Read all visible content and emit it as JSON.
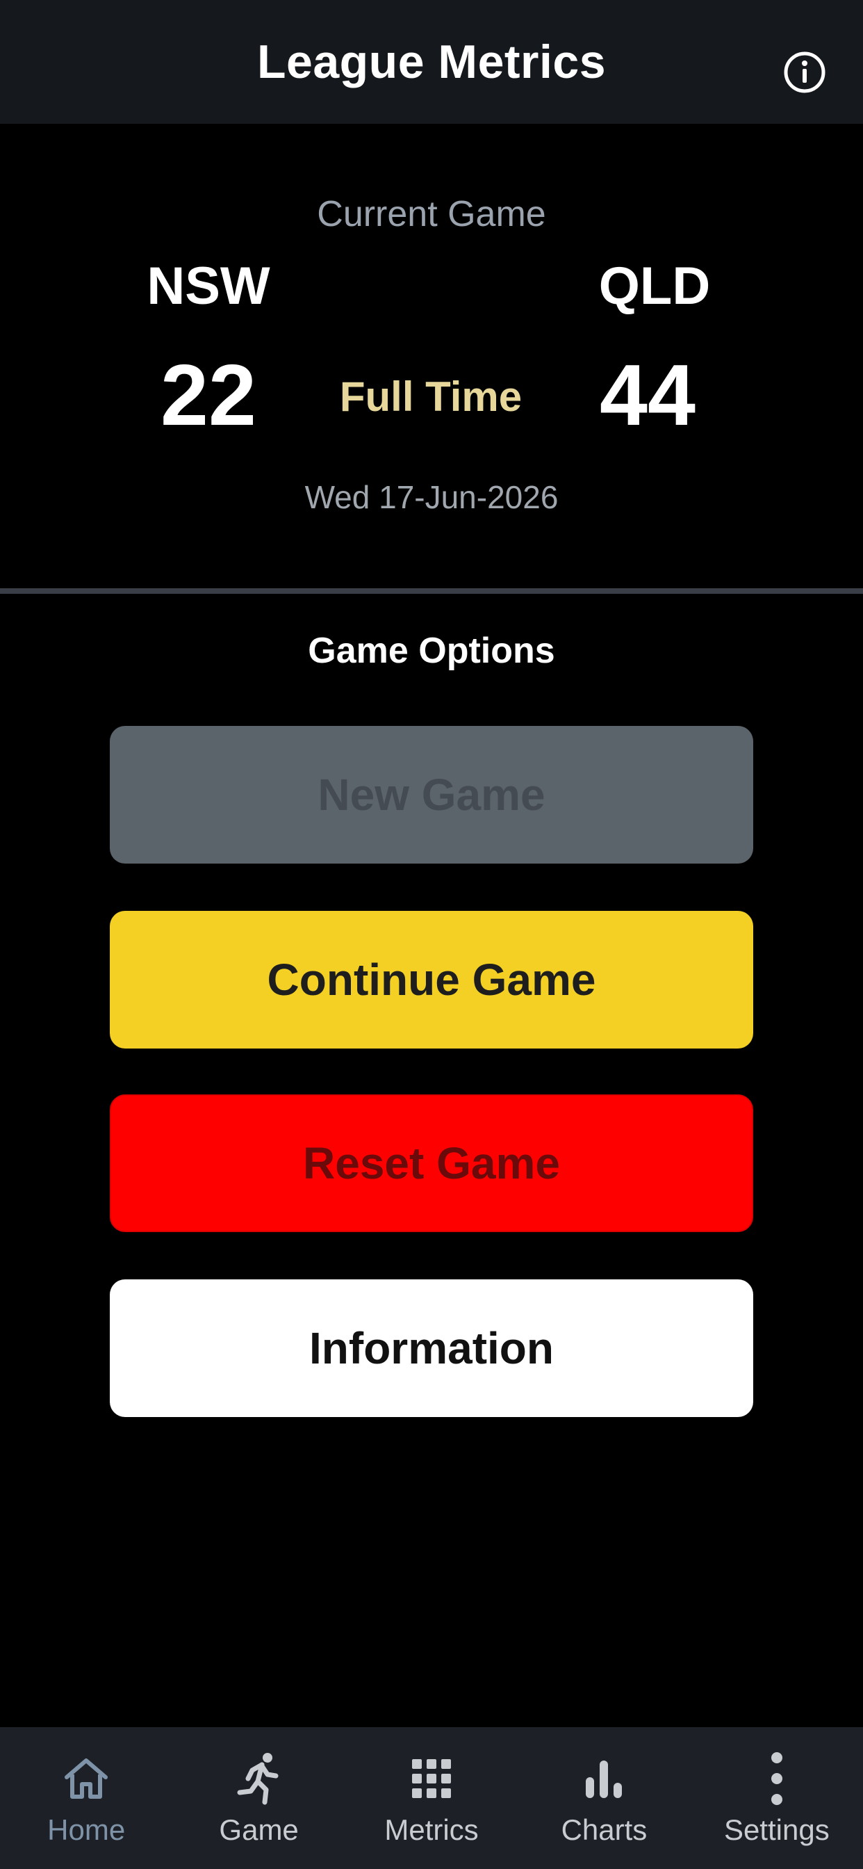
{
  "header": {
    "title": "League Metrics"
  },
  "game": {
    "current_label": "Current Game",
    "home_team": "NSW",
    "away_team": "QLD",
    "home_score": "22",
    "away_score": "44",
    "status": "Full Time",
    "date": "Wed 17-Jun-2026"
  },
  "options": {
    "title": "Game Options",
    "new_game": "New Game",
    "continue_game": "Continue Game",
    "reset_game": "Reset Game",
    "information": "Information"
  },
  "nav": {
    "items": [
      {
        "label": "Home",
        "icon": "home-icon"
      },
      {
        "label": "Game",
        "icon": "runner-icon"
      },
      {
        "label": "Metrics",
        "icon": "grid-icon"
      },
      {
        "label": "Charts",
        "icon": "bar-chart-icon"
      },
      {
        "label": "Settings",
        "icon": "more-vertical-icon"
      }
    ],
    "active_index": 0
  },
  "colors": {
    "background": "#000000",
    "header": "#15181d",
    "continue": "#f3d023",
    "reset": "#ff0000",
    "disabled": "#5b636b",
    "status": "#e8d79a",
    "nav_active": "#7f93a8"
  }
}
